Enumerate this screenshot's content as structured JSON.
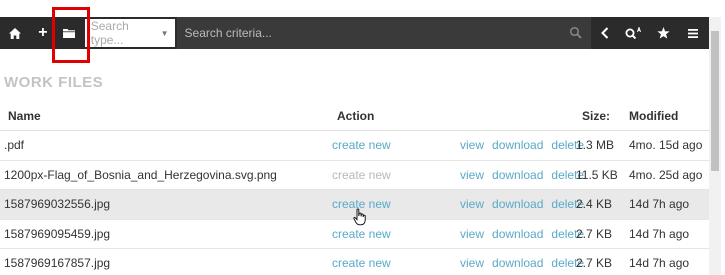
{
  "toolbar": {
    "search_type_placeholder": "Search type...",
    "search_criteria_placeholder": "Search criteria...",
    "plus_label": "+"
  },
  "section": {
    "title": "WORK FILES"
  },
  "table": {
    "headers": {
      "name": "Name",
      "action": "Action",
      "size": "Size:",
      "modified": "Modified"
    },
    "rows": [
      {
        "name": ".pdf",
        "action": "create new",
        "view": "view",
        "download": "download",
        "delete": "delete",
        "size": "1.3 MB",
        "modified": "4mo. 15d ago"
      },
      {
        "name": "1200px-Flag_of_Bosnia_and_Herzegovina.svg.png",
        "action": "create new",
        "view": "view",
        "download": "download",
        "delete": "delete",
        "size": "11.5 KB",
        "modified": "4mo. 25d ago"
      },
      {
        "name": "1587969032556.jpg",
        "action": "create new",
        "view": "view",
        "download": "download",
        "delete": "delete",
        "size": "2.4 KB",
        "modified": "14d 7h ago"
      },
      {
        "name": "1587969095459.jpg",
        "action": "create new",
        "view": "view",
        "download": "download",
        "delete": "delete",
        "size": "2.7 KB",
        "modified": "14d 7h ago"
      },
      {
        "name": "1587969167857.jpg",
        "action": "create new",
        "view": "view",
        "download": "download",
        "delete": "delete",
        "size": "2.7 KB",
        "modified": "14d 7h ago"
      }
    ]
  },
  "colors": {
    "toolbar_bg": "#2b2b2b",
    "link": "#5aa9c8",
    "highlight": "#e00000",
    "section_title": "#c3c3c3"
  },
  "icons": [
    "home-icon",
    "plus-icon",
    "folder-icon",
    "search-icon",
    "back-icon",
    "quick-search-icon",
    "star-icon",
    "menu-icon",
    "pointer-cursor-icon"
  ]
}
